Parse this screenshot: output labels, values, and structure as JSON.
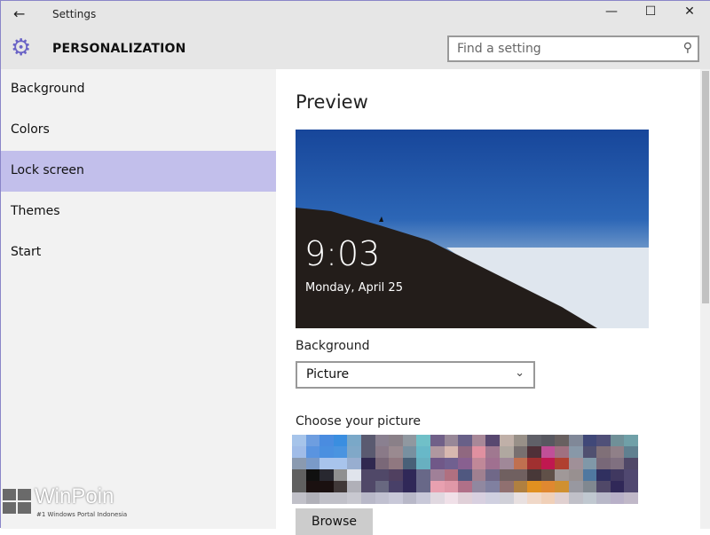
{
  "window": {
    "title": "Settings",
    "back_icon": "arrow-left-icon",
    "minimize": "—",
    "maximize": "☐",
    "close": "✕"
  },
  "header": {
    "title": "PERSONALIZATION",
    "icon": "gear-icon",
    "search_placeholder": "Find a setting"
  },
  "sidebar": {
    "items": [
      {
        "label": "Background"
      },
      {
        "label": "Colors"
      },
      {
        "label": "Lock screen",
        "selected": true
      },
      {
        "label": "Themes"
      },
      {
        "label": "Start"
      }
    ]
  },
  "main": {
    "preview_title": "Preview",
    "preview_time": "9:03",
    "preview_date": "Monday, April 25",
    "background_label": "Background",
    "background_value": "Picture",
    "choose_label": "Choose your picture",
    "browse_label": "Browse"
  },
  "watermark": {
    "name": "WinPoin",
    "tagline": "#1 Windows Portal Indonesia"
  },
  "colors": {
    "accent": "#6a63c6",
    "selected": "#c2bfeb"
  }
}
